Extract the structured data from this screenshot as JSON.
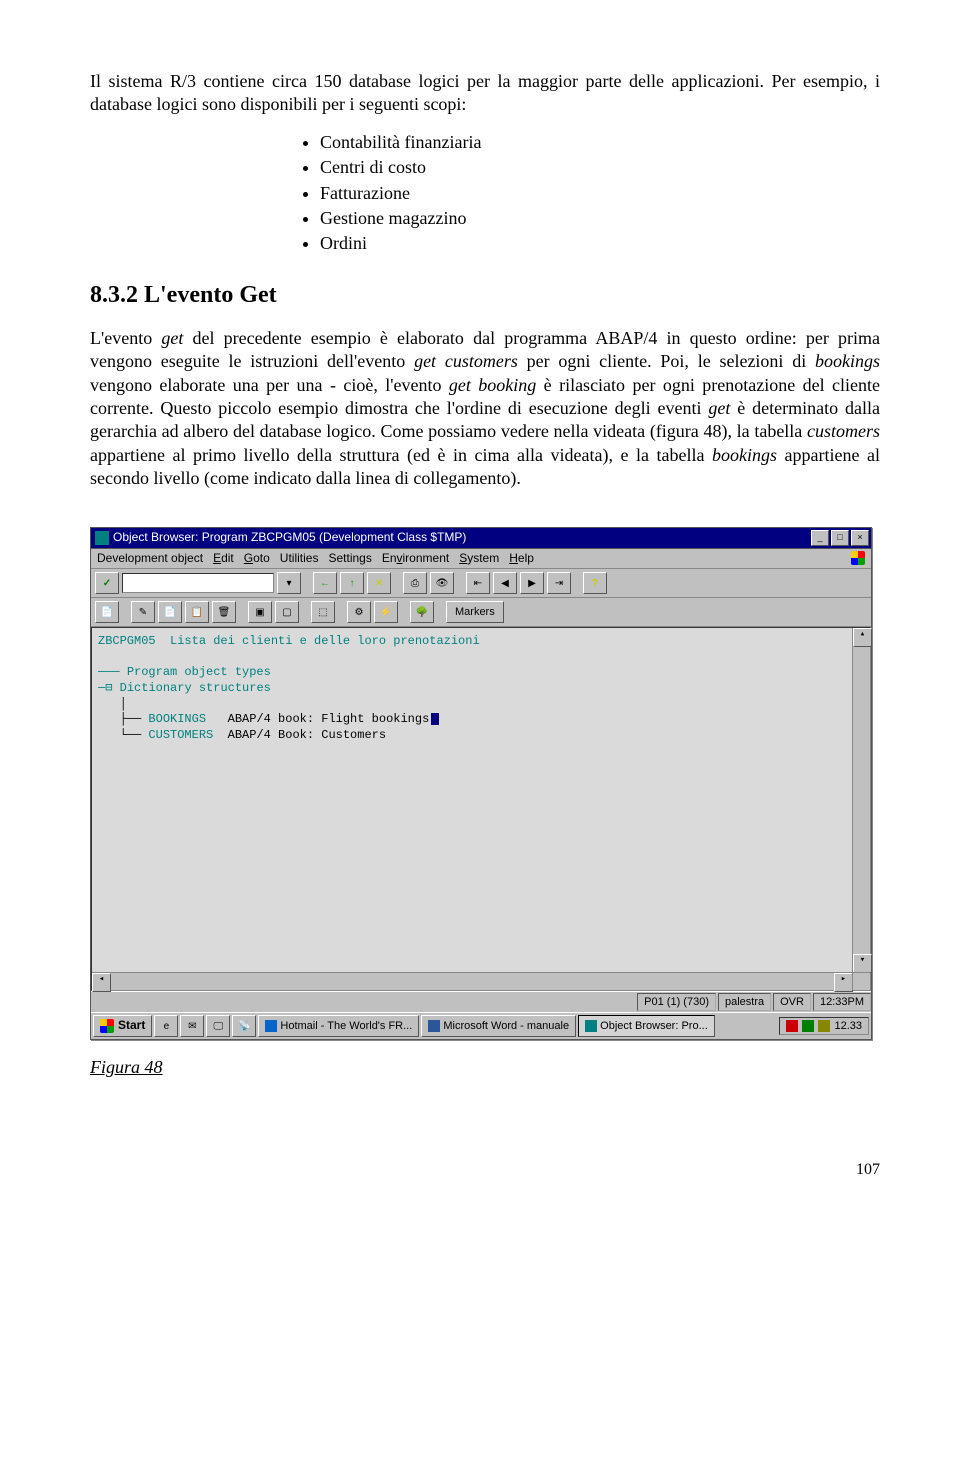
{
  "para1_a": "Il sistema R/3 contiene circa 150 database logici per la maggior parte delle applicazioni. Per esempio, i database logici sono disponibili per i seguenti scopi:",
  "bullets": {
    "b1": "Contabilità finanziaria",
    "b2": "Centri di costo",
    "b3": "Fatturazione",
    "b4": "Gestione magazzino",
    "b5": "Ordini"
  },
  "heading": "8.3.2  L'evento Get",
  "para2_a": "L'evento ",
  "para2_b": " del precedente esempio è elaborato dal programma ABAP/4 in questo ordine: per prima vengono eseguite le istruzioni dell'evento ",
  "para2_c": " per ogni cliente. Poi, le selezioni di ",
  "para2_d": " vengono elaborate una per una - cioè, l'evento ",
  "para2_e": " è rilasciato per ogni prenotazione del cliente corrente. Questo piccolo esempio dimostra che l'ordine di esecuzione degli eventi ",
  "para2_f": " è determinato dalla gerarchia ad albero del database logico. Come possiamo vedere nella videata (figura 48), la tabella ",
  "para2_g": " appartiene al primo livello della struttura (ed è in cima alla videata), e la tabella ",
  "para2_h": " appartiene al secondo livello (come indicato dalla linea di collegamento).",
  "em": {
    "get": "get",
    "getcust": "get customers",
    "bookings": "bookings",
    "getbook": "get booking",
    "customers": "customers"
  },
  "sap": {
    "title": "Object Browser: Program ZBCPGM05 (Development Class $TMP)",
    "menu": {
      "m1": "Development object",
      "m2": "Edit",
      "m3": "Goto",
      "m4": "Utilities",
      "m5": "Settings",
      "m6": "Environment",
      "m7": "System",
      "m8": "Help"
    },
    "markers": "Markers",
    "line1": "ZBCPGM05  Lista dei clienti e delle loro prenotazioni",
    "line2": "Program object types",
    "line3": "Dictionary structures",
    "line4a": "BOOKINGS",
    "line4b": "ABAP/4 book: Flight bookings",
    "line5a": "CUSTOMERS",
    "line5b": "ABAP/4 Book: Customers",
    "status": {
      "s1": "P01 (1) (730)",
      "s2": "palestra",
      "s3": "OVR",
      "s4": "12:33PM"
    },
    "taskbar": {
      "start": "Start",
      "t1": "Hotmail - The World's FR...",
      "t2": "Microsoft Word - manuale",
      "t3": "Object Browser: Pro...",
      "clock": "12.33"
    }
  },
  "figlabel": "Figura 48",
  "pagenum": "107"
}
